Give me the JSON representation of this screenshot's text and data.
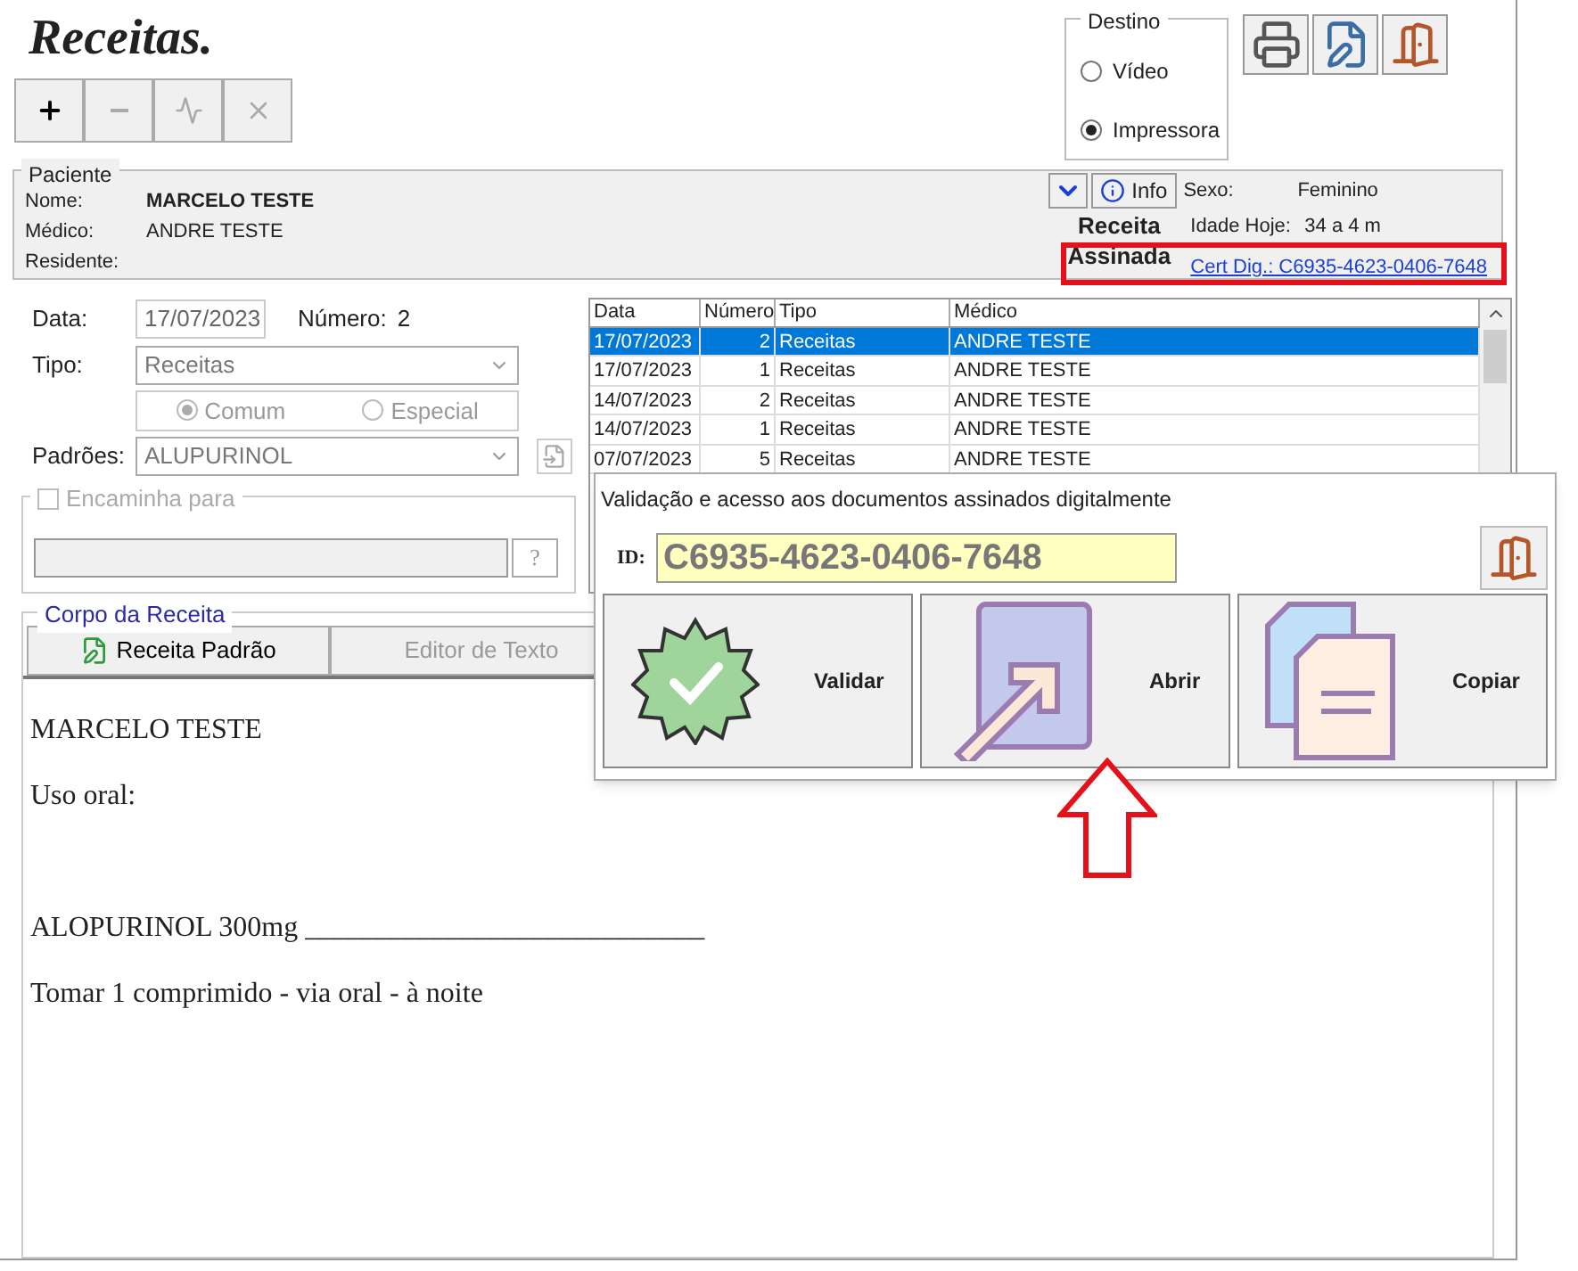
{
  "title": "Receitas.",
  "toolbar": [
    {
      "kind": "add",
      "disabled": false
    },
    {
      "kind": "minus",
      "disabled": true
    },
    {
      "kind": "edit",
      "disabled": true
    },
    {
      "kind": "delete",
      "disabled": true
    }
  ],
  "destino": {
    "legend": "Destino",
    "options": [
      {
        "label": "Vídeo",
        "selected": false
      },
      {
        "label": "Impressora",
        "selected": true
      }
    ]
  },
  "action_icons": [
    {
      "kind": "printer"
    },
    {
      "kind": "edit"
    },
    {
      "kind": "exit"
    }
  ],
  "paciente": {
    "legend": "Paciente",
    "fields": [
      {
        "label": "Nome:",
        "value": "MARCELO TESTE",
        "bold": true
      },
      {
        "label": "Médico:",
        "value": "ANDRE TESTE",
        "bold": false
      },
      {
        "label": "Residente:"
      }
    ],
    "info_button": "Info",
    "info": [
      {
        "label": "Sexo:",
        "value": "Feminino"
      },
      {
        "label": "Idade Hoje:",
        "value": "34 a 4 m"
      }
    ],
    "signed_top": "Receita",
    "signed_bottom": "Assinada",
    "cert_link": "Cert Dig.: C6935-4623-0406-7648"
  },
  "form": {
    "data_label": "Data:",
    "data_value": "17/07/2023",
    "numero_label": "Número:",
    "numero_value": "2",
    "tipo_label": "Tipo:",
    "tipo_value": "Receitas",
    "tipo_options": [
      {
        "label": "Comum",
        "selected": true
      },
      {
        "label": "Especial",
        "selected": false
      }
    ],
    "padroes_label": "Padrões:",
    "padroes_value": "ALUPURINOL",
    "encaminha_label": "Encaminha para",
    "encaminha_checked": false,
    "help_button": "?"
  },
  "table": {
    "columns": [
      "Data",
      "Número",
      "Tipo",
      "Médico"
    ],
    "rows": [
      {
        "cells": [
          "17/07/2023",
          "2",
          "Receitas",
          "ANDRE TESTE"
        ],
        "selected": true
      },
      {
        "cells": [
          "17/07/2023",
          "1",
          "Receitas",
          "ANDRE TESTE"
        ],
        "selected": false
      },
      {
        "cells": [
          "14/07/2023",
          "2",
          "Receitas",
          "ANDRE TESTE"
        ],
        "selected": false
      },
      {
        "cells": [
          "14/07/2023",
          "1",
          "Receitas",
          "ANDRE TESTE"
        ],
        "selected": false
      },
      {
        "cells": [
          "07/07/2023",
          "5",
          "Receitas",
          "ANDRE TESTE"
        ],
        "selected": false
      }
    ]
  },
  "corpo": {
    "legend": "Corpo da Receita",
    "buttons": [
      {
        "label": "Receita Padrão",
        "disabled": false
      },
      {
        "label": "Editor de Texto",
        "disabled": true
      }
    ],
    "text": "MARCELO TESTE\n\nUso oral:\n\n\n\nALOPURINOL 300mg ____________________________\n\nTomar 1 comprimido - via oral - à noite"
  },
  "popup": {
    "title": "Validação e acesso aos documentos assinados digitalmente",
    "id_label": "ID:",
    "id_value": "C6935-4623-0406-7648",
    "buttons": [
      {
        "kind": "validate",
        "label": "Validar"
      },
      {
        "kind": "open",
        "label": "Abrir"
      },
      {
        "kind": "copy",
        "label": "Copiar"
      }
    ]
  }
}
